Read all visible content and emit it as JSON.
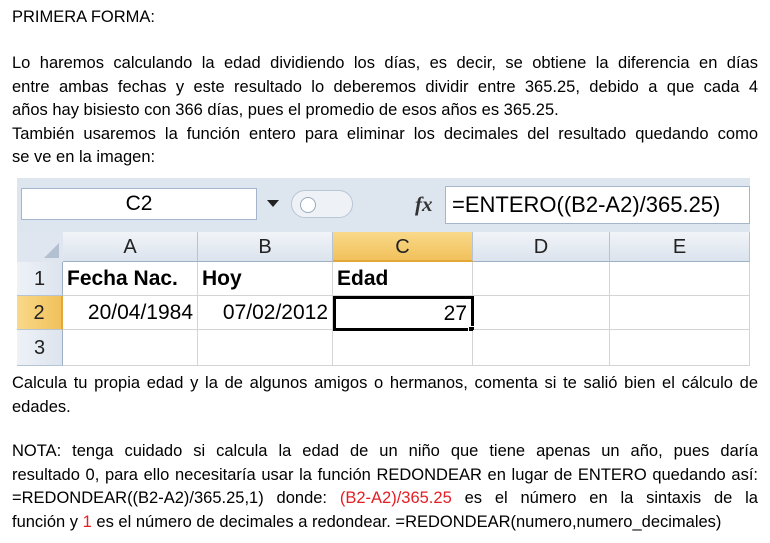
{
  "heading": "PRIMERA FORMA:",
  "intro_lines": [
    "Lo haremos  calculando la edad dividiendo los días, es decir, se obtiene la diferencia en días",
    "entre ambas fechas y este resultado lo deberemos dividir entre 365.25, debido a que cada 4",
    "años hay bisiesto con 366 días, pues el promedio de esos años es 365.25.",
    "También usaremos la función entero para eliminar los decimales del resultado quedando como",
    "se ve en la imagen:"
  ],
  "spreadsheet": {
    "name_box": "C2",
    "fx_symbol": "fx",
    "formula": "=ENTERO((B2-A2)/365.25)",
    "columns": [
      "A",
      "B",
      "C",
      "D",
      "E"
    ],
    "rows": [
      "1",
      "2",
      "3"
    ],
    "selected_column": "C",
    "selected_row": "2",
    "cells": {
      "A1": "Fecha Nac.",
      "B1": "Hoy",
      "C1": "Edad",
      "A2": "20/04/1984",
      "B2": "07/02/2012",
      "C2": "27"
    }
  },
  "exercise_lines": [
    "Calcula tu propia edad y la de algunos amigos o hermanos, comenta si te salió bien el cálculo de",
    "edades."
  ],
  "nota": {
    "line1": "NOTA: tenga cuidado si calcula la edad de un niño que tiene apenas un año, pues daría",
    "line2": "resultado 0, para ello necesitaría usar la función REDONDEAR en lugar de ENTERO quedando así:",
    "line3_a": "=REDONDEAR((B2-A2)/365.25,1)  donde:",
    "line3_red": "(B2-A2)/365.25",
    "line3_b": "es el número en la sintaxis de la",
    "line4_a": "función y",
    "line4_red": "1",
    "line4_b": "es el número de decimales a redondear. =REDONDEAR(numero,numero_decimales)"
  },
  "colors": {
    "highlight_red": "#e31e24",
    "selected_header": "#f1c15b"
  }
}
